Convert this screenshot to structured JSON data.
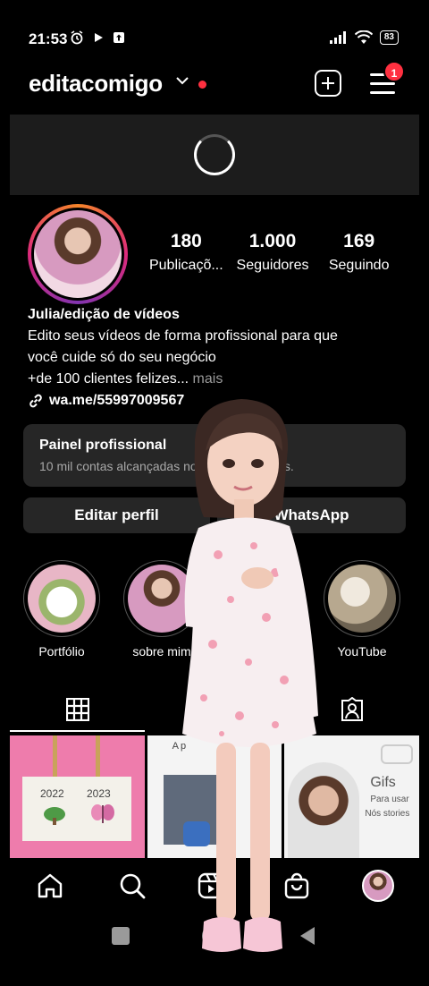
{
  "status": {
    "time": "21:53",
    "battery": "83"
  },
  "header": {
    "username": "editacomigo",
    "notification_count": "1"
  },
  "profile": {
    "stats": [
      {
        "value": "180",
        "label": "Publicaçõ..."
      },
      {
        "value": "1.000",
        "label": "Seguidores"
      },
      {
        "value": "169",
        "label": "Seguindo"
      }
    ],
    "bio": {
      "name": "Julia/edição de vídeos",
      "line1": "Edito seus vídeos de forma profissional para que",
      "line2": "você cuide só do seu negócio",
      "line3": "+de 100 clientes felizes...",
      "more": " mais",
      "link": "wa.me/55997009567"
    }
  },
  "pro_panel": {
    "title": "Painel profissional",
    "subtitle": "10 mil contas alcançadas nos últimos 30 dias."
  },
  "actions": {
    "edit": "Editar perfil",
    "whatsapp": "WhatsApp"
  },
  "highlights": [
    {
      "label": "Portfólio"
    },
    {
      "label": "sobre mim"
    },
    {
      "label": ""
    },
    {
      "label": "YouTube"
    }
  ],
  "posts": {
    "post1": {
      "year_a": "2022",
      "year_b": "2023"
    },
    "post2": {
      "caption": "Ap"
    },
    "post3": {
      "title": "Gifs",
      "sub1": "Para usar",
      "sub2": "Nós stories"
    }
  },
  "colors": {
    "accent_red": "#ff3040",
    "surface": "#262626"
  }
}
